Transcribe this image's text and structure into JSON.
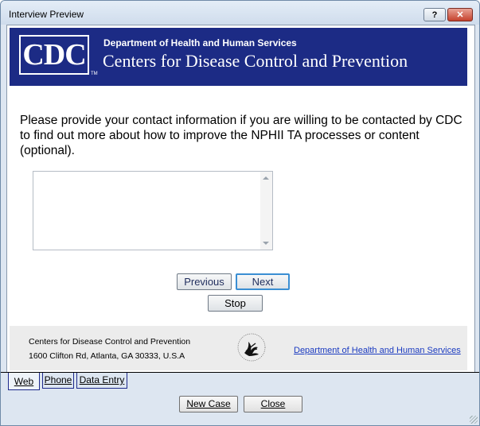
{
  "window": {
    "title": "Interview Preview",
    "help_label": "?",
    "close_label": "✕"
  },
  "banner": {
    "logo_text": "CDC",
    "trademark": "TM",
    "department": "Department of Health and Human Services",
    "centers": "Centers for Disease Control and Prevention"
  },
  "question": {
    "prompt": "Please provide your contact information if you are willing to be contacted by CDC to find out more about how to improve the NPHII TA processes or content (optional).",
    "answer_value": ""
  },
  "nav": {
    "previous_label": "Previous",
    "next_label": "Next",
    "stop_label": "Stop"
  },
  "footer": {
    "org_name": "Centers for Disease Control and Prevention",
    "address": "1600 Clifton Rd, Atlanta, GA 30333, U.S.A",
    "hhs_link": "Department of Health and Human Services"
  },
  "tabs": [
    {
      "label": "Web",
      "active": true
    },
    {
      "label": "Phone",
      "active": false
    },
    {
      "label": "Data Entry",
      "active": false
    }
  ],
  "actions": {
    "new_case_label": "New Case",
    "close_label": "Close"
  }
}
